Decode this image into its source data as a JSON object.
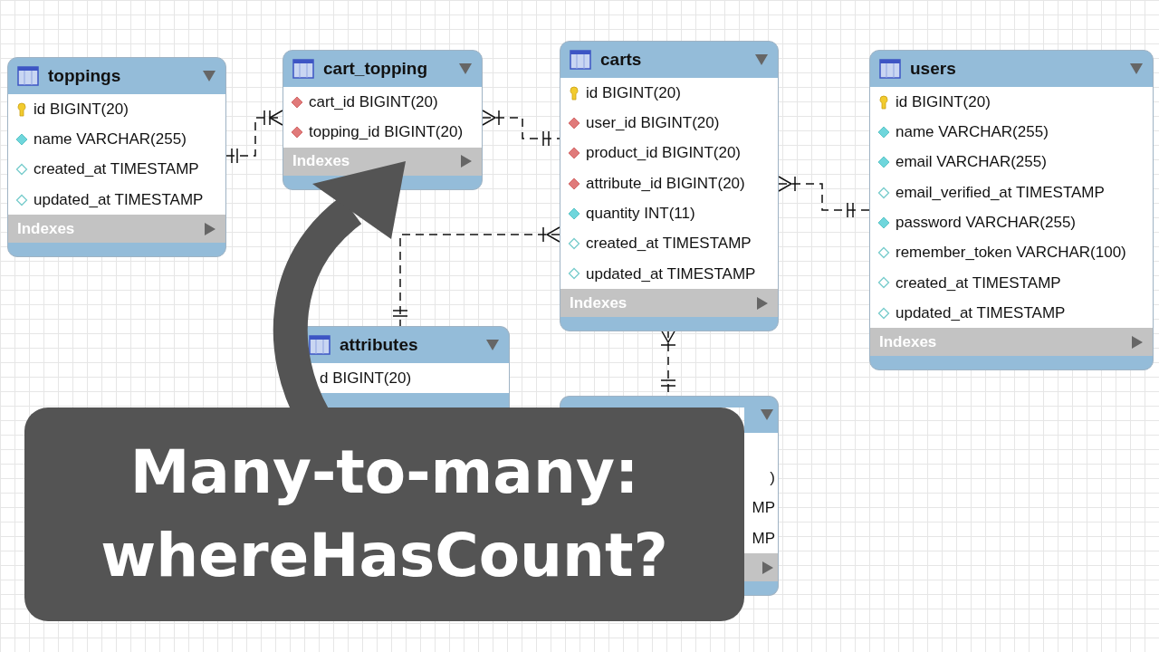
{
  "tables": [
    {
      "name": "toppings",
      "columns": [
        {
          "kind": "primary",
          "text": "id BIGINT(20)"
        },
        {
          "kind": "not_null",
          "text": "name VARCHAR(255)"
        },
        {
          "kind": "nullable",
          "text": "created_at TIMESTAMP"
        },
        {
          "kind": "nullable",
          "text": "updated_at TIMESTAMP"
        }
      ],
      "indexes": "Indexes"
    },
    {
      "name": "cart_topping",
      "columns": [
        {
          "kind": "foreign",
          "text": "cart_id BIGINT(20)"
        },
        {
          "kind": "foreign",
          "text": "topping_id BIGINT(20)"
        }
      ],
      "indexes": "Indexes"
    },
    {
      "name": "carts",
      "columns": [
        {
          "kind": "primary",
          "text": "id BIGINT(20)"
        },
        {
          "kind": "foreign",
          "text": "user_id BIGINT(20)"
        },
        {
          "kind": "foreign",
          "text": "product_id BIGINT(20)"
        },
        {
          "kind": "foreign",
          "text": "attribute_id BIGINT(20)"
        },
        {
          "kind": "not_null",
          "text": "quantity INT(11)"
        },
        {
          "kind": "nullable",
          "text": "created_at TIMESTAMP"
        },
        {
          "kind": "nullable",
          "text": "updated_at TIMESTAMP"
        }
      ],
      "indexes": "Indexes"
    },
    {
      "name": "users",
      "columns": [
        {
          "kind": "primary",
          "text": "id BIGINT(20)"
        },
        {
          "kind": "not_null",
          "text": "name VARCHAR(255)"
        },
        {
          "kind": "not_null",
          "text": "email VARCHAR(255)"
        },
        {
          "kind": "nullable",
          "text": "email_verified_at TIMESTAMP"
        },
        {
          "kind": "not_null",
          "text": "password VARCHAR(255)"
        },
        {
          "kind": "nullable",
          "text": "remember_token VARCHAR(100)"
        },
        {
          "kind": "nullable",
          "text": "created_at TIMESTAMP"
        },
        {
          "kind": "nullable",
          "text": "updated_at TIMESTAMP"
        }
      ],
      "indexes": "Indexes"
    },
    {
      "name": "attributes",
      "columns": [
        {
          "kind": "covered",
          "text": "d BIGINT(20)"
        }
      ]
    },
    {
      "columns": [
        {
          "kind": "hidden"
        },
        {
          "kind": "hidden",
          "text": ")"
        },
        {
          "kind": "hidden",
          "text": "MP"
        },
        {
          "kind": "hidden",
          "text": "MP"
        }
      ]
    }
  ],
  "banner": {
    "lines": [
      "Many-to-many:",
      "whereHasCount?"
    ]
  }
}
